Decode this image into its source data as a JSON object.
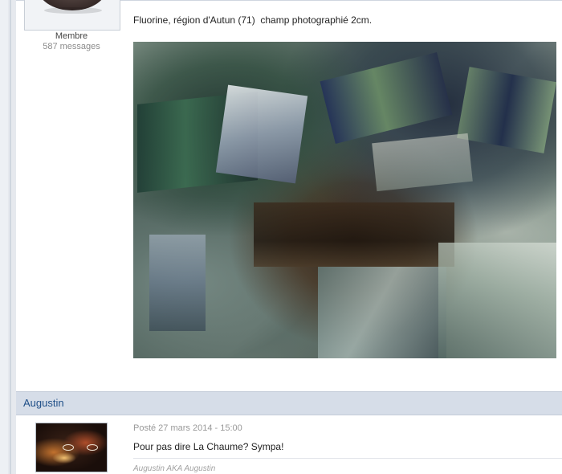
{
  "post1": {
    "author_role": "Membre",
    "author_messages": "587 messages",
    "text": "Fluorine, région d'Autun (71)  champ photographié 2cm."
  },
  "post2": {
    "author_name": "Augustin",
    "date": "Posté 27 mars 2014 - 15:00",
    "text": "Pour pas dire La Chaume? Sympa!",
    "signature": "Augustin AKA Augustin"
  }
}
